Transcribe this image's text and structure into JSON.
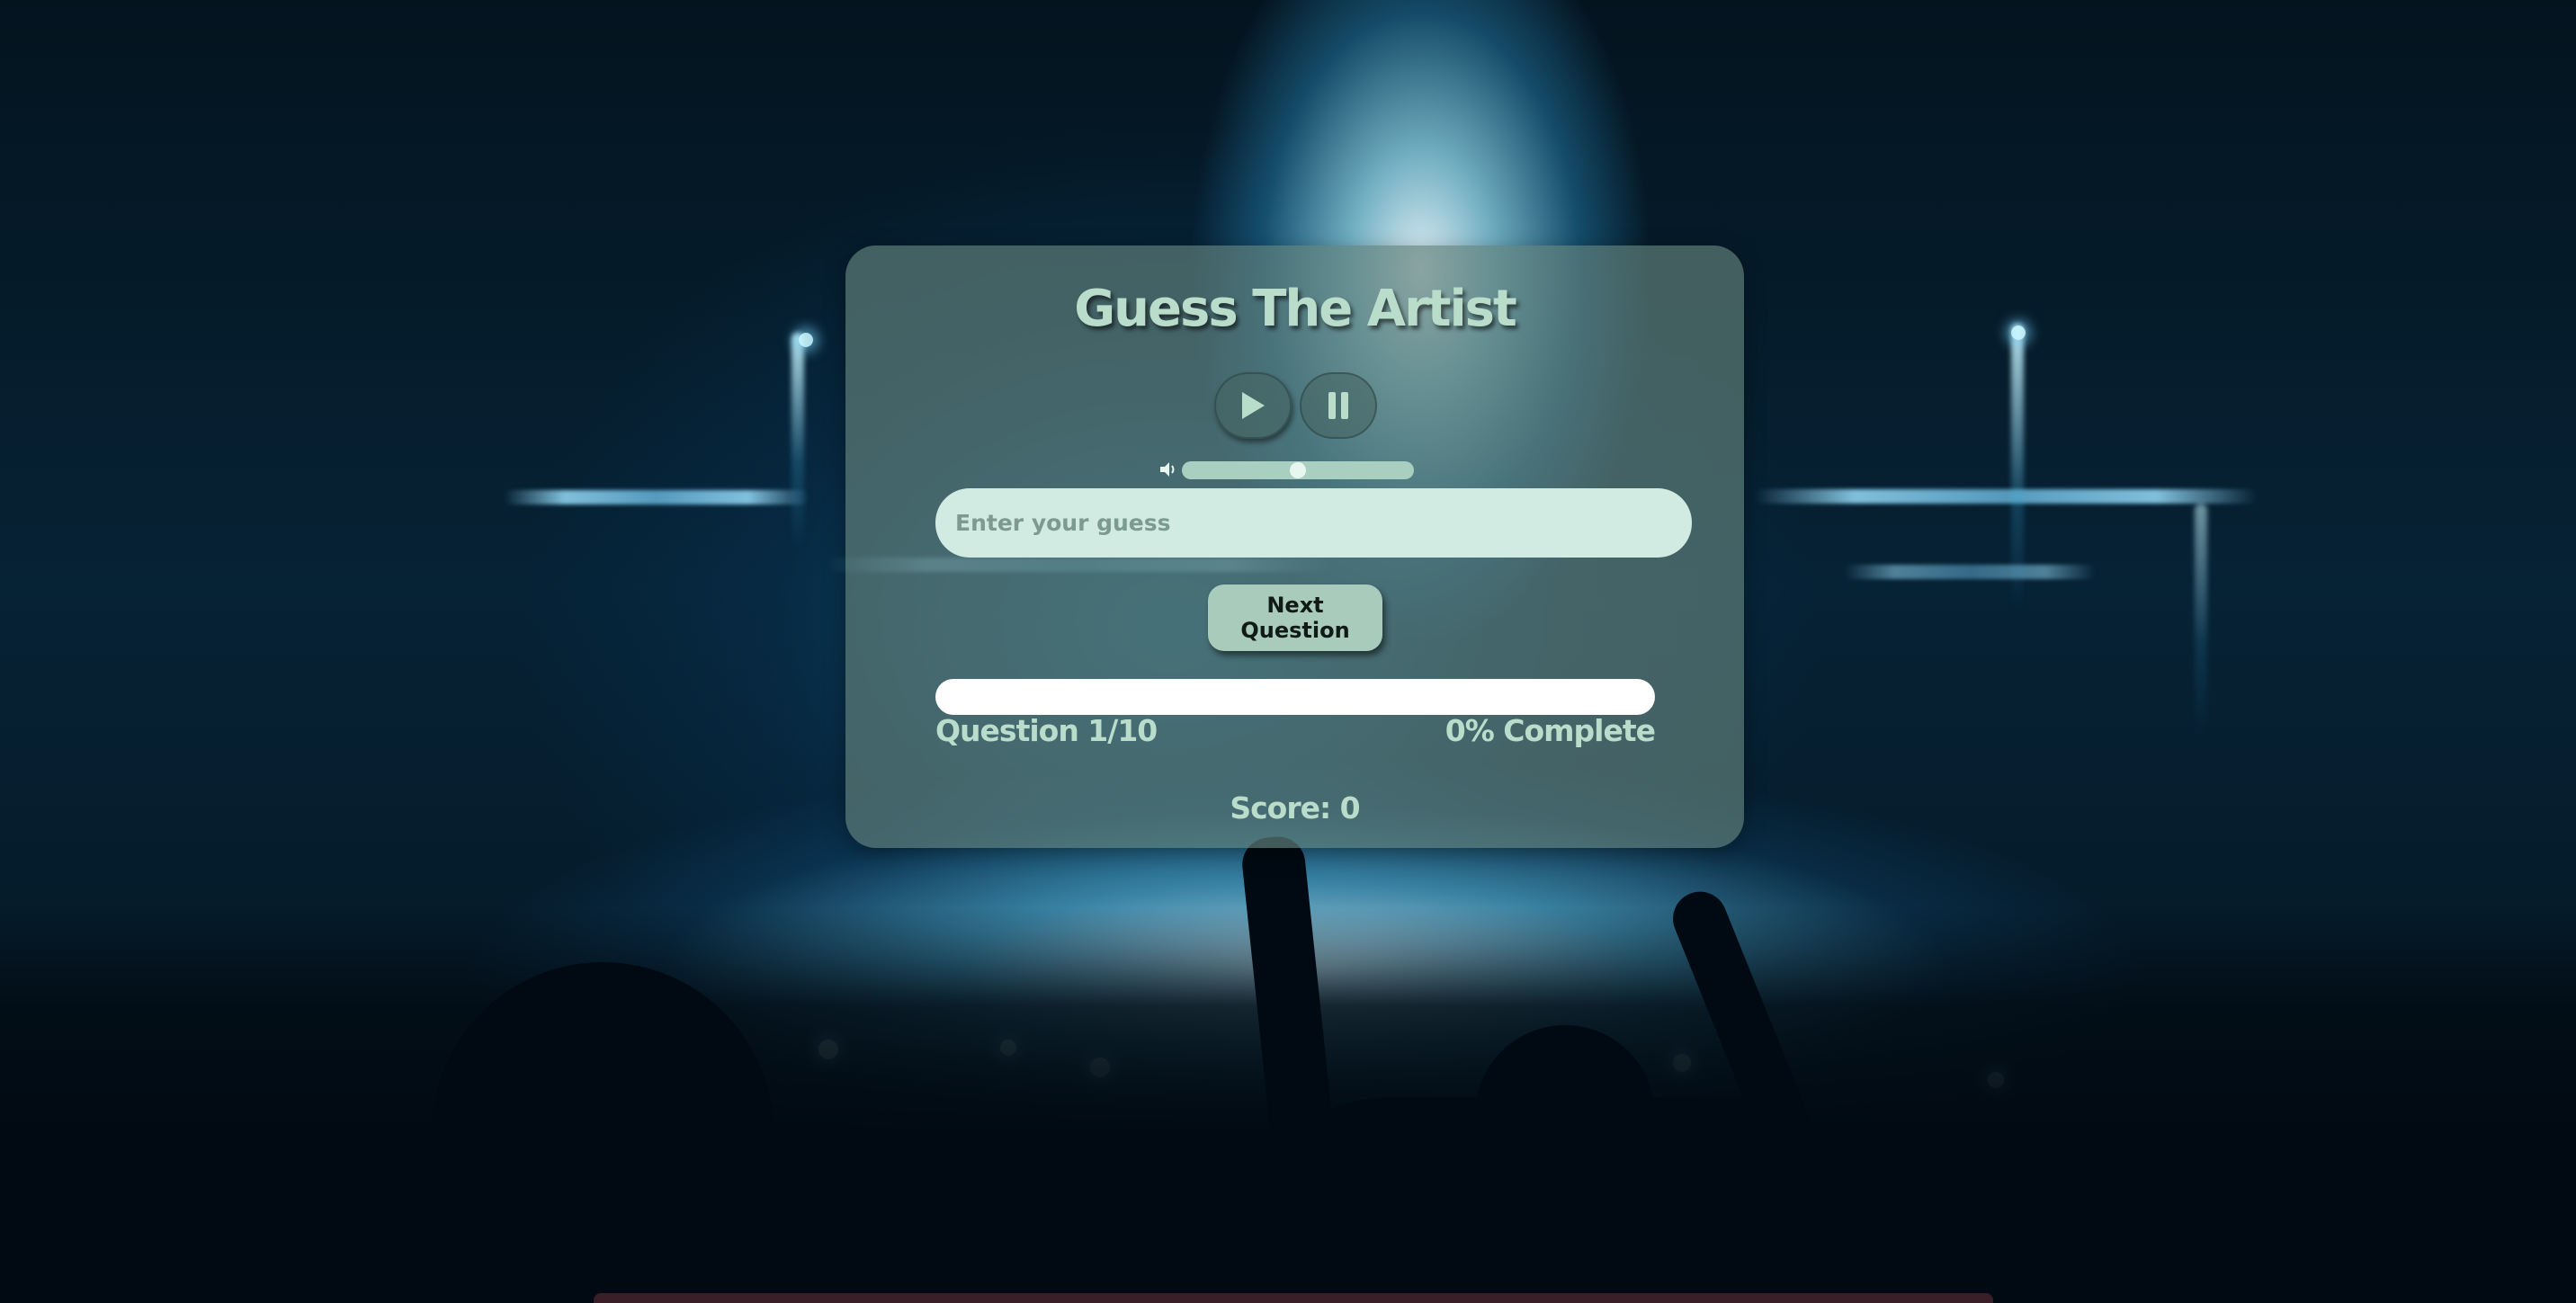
{
  "game": {
    "title": "Guess The Artist",
    "guess_placeholder": "Enter your guess",
    "guess_value": "",
    "next_button_label": "Next Question",
    "question_label": "Question 1/10",
    "complete_label": "0% Complete",
    "progress_fraction": 0.0,
    "volume_fraction": 0.5,
    "score_label": "Score: 0"
  },
  "icons": {
    "play": "play-icon",
    "pause": "pause-icon",
    "volume": "volume-icon"
  },
  "colors": {
    "title_text": "#b9dccb",
    "card_background": "rgba(98,128,122,0.68)",
    "input_background": "#d2ebe2",
    "button_background": "#a8cbbb",
    "progress_track": "#ffffff"
  }
}
